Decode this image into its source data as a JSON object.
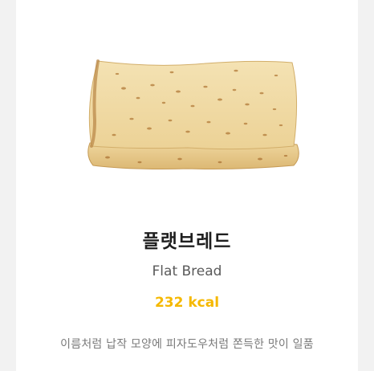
{
  "product": {
    "name_ko": "플랫브레드",
    "name_en": "Flat Bread",
    "calories": "232 kcal",
    "description": "이름처럼 납작 모양에 피자도우처럼 쫀득한 맛이 일품",
    "image_alt": "flat bread"
  },
  "colors": {
    "calories": "#f5b800",
    "bread": "#efd9a2",
    "toast": "#b07a3a"
  }
}
